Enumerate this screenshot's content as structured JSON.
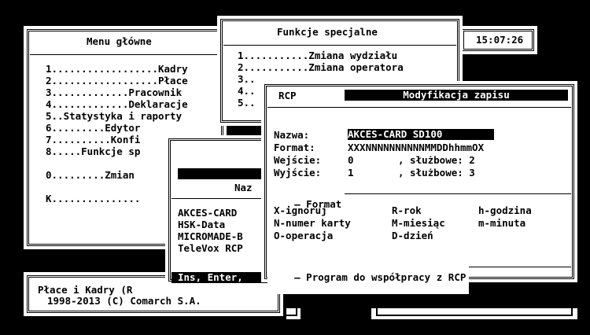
{
  "main_menu": {
    "title": "Menu główne",
    "items": [
      "1..................Kadry",
      "2..................Płace",
      "3.............Pracownik",
      "4.............Deklaracje",
      "5..Statystyka i raporty",
      "6.........Edytor",
      "7..........Konfi",
      "8.....Funkcje sp",
      "",
      "0.........Zmian",
      "",
      "K..............."
    ]
  },
  "clock": {
    "time": "15:07:26"
  },
  "special_functions": {
    "title": "Funkcje specjalne",
    "items": [
      "1...........Zmiana wydziału",
      "2...........Zmiana operatora",
      "3..",
      "4..",
      "5.."
    ]
  },
  "rcp_list": {
    "header_label": "Naz",
    "items": [
      "AKCES-CARD",
      "HSK-Data",
      "MICROMADE-B",
      "TeleVox RCP"
    ],
    "status": "Ins, Enter,"
  },
  "footer": {
    "line1": "Płace i Kadry (R",
    "line2": "1998-2013 (C) Comarch S.A."
  },
  "dialog": {
    "tag": "RCP",
    "title": "Modyfikacja zapisu",
    "fields": {
      "name_label": "Nazwa:",
      "name_value": "AKCES-CARD SD100",
      "format_label": "Format:",
      "format_value": "XXXNNNNNNNNNNMMDDhhmmOX",
      "entry_label": "Wejście:",
      "entry_value": "0",
      "entry_service": ", służbowe: 2",
      "exit_label": "Wyjście:",
      "exit_value": "1",
      "exit_service": ", służbowe: 3"
    },
    "format_section": {
      "title": "Format",
      "legend": [
        [
          "X-ignoruj",
          "R-rok",
          "h-godzina"
        ],
        [
          "N-numer karty",
          "M-miesiąc",
          "m-minuta"
        ],
        [
          "O-operacja",
          "D-dzień",
          ""
        ]
      ]
    },
    "program_section": {
      "title": "Program do współpracy z RCP"
    }
  }
}
